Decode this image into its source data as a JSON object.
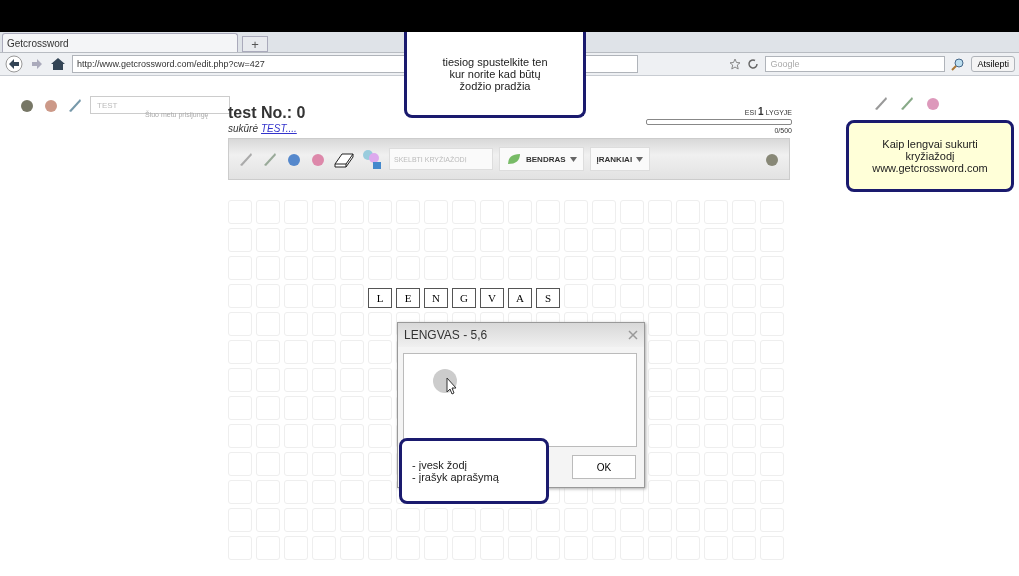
{
  "browser": {
    "tab": {
      "title": "Getcrossword",
      "selected": true
    },
    "new_tab": "+",
    "url": "http://www.getcrossword.com/edit.php?cw=427",
    "search": {
      "placeholder": "Google"
    },
    "menu_button": "Atsilepti"
  },
  "site": {
    "search": {
      "placeholder": "TEST"
    },
    "online_note": "Šiuo metu prisijungę",
    "title": "test No.: 0",
    "author_label": "sukūrė",
    "author_link": "TEST....",
    "level": {
      "prefix": "ESI",
      "number": "1",
      "suffix": "LYGYJE",
      "level": 0,
      "reading": "0/500"
    },
    "toolbar": {
      "publish": {
        "placeholder": "SKELBTI KRYŽIAŽODĮ"
      },
      "menus": [
        {
          "label": "BENDRAS",
          "kind": "icon-dropdown"
        },
        {
          "label": "ĮRANKIAI",
          "kind": "dropdown"
        }
      ]
    },
    "word": {
      "letters": [
        "L",
        "E",
        "N",
        "G",
        "V",
        "A",
        "S"
      ]
    },
    "dialog": {
      "title": "LENGVAS - 5,6",
      "button": "OK"
    }
  },
  "callouts": [
    {
      "kind": "note",
      "lines": [
        "tiesiog spustelkite ten",
        "kur norite kad būtų",
        "žodžio pradžia"
      ]
    },
    {
      "kind": "highlight",
      "lines": [
        "Kaip lengvai sukurti",
        "kryžiažodį",
        "www.getcrossword.com"
      ]
    },
    {
      "kind": "list",
      "lines": [
        "- įvesk žodį",
        "- įrašyk aprašymą"
      ]
    }
  ]
}
